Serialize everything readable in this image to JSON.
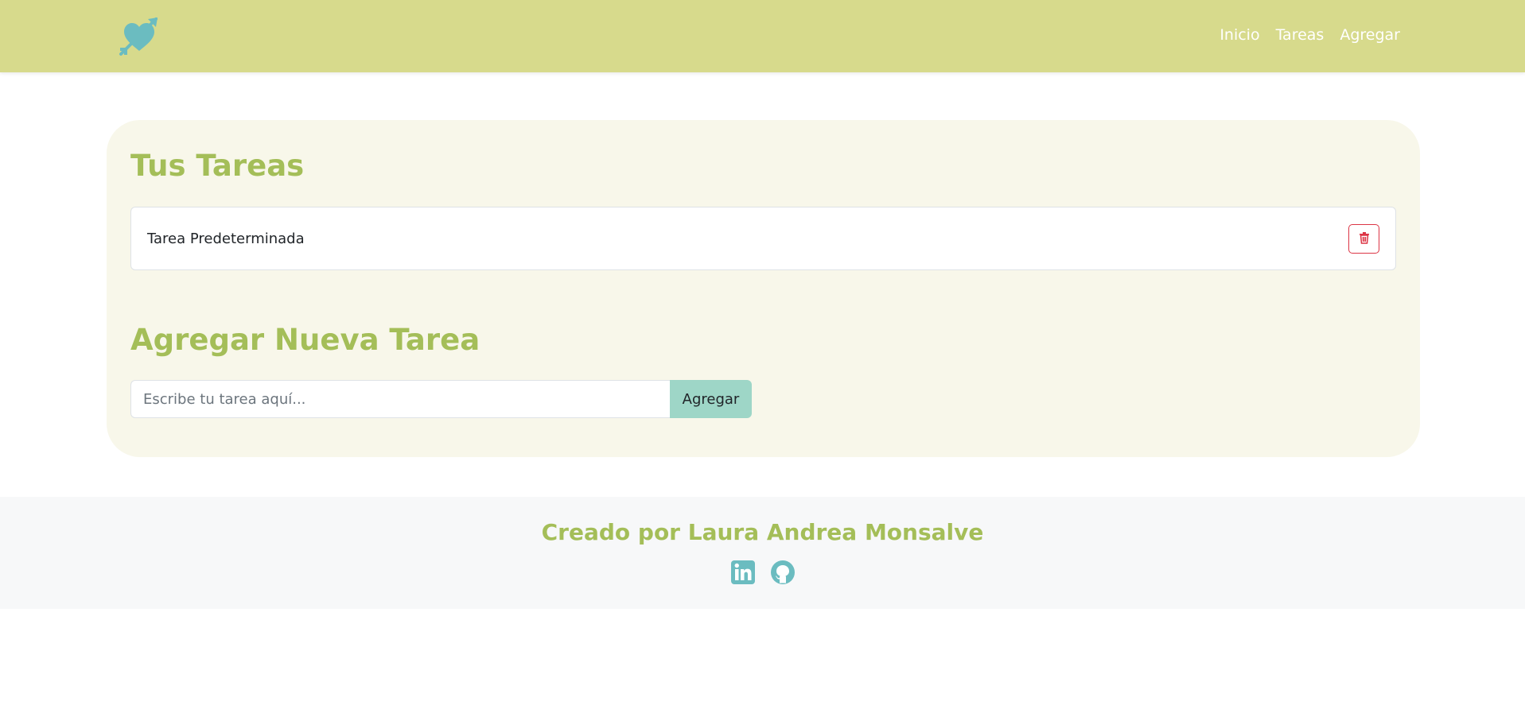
{
  "navbar": {
    "logo_icon": "heart-arrow-icon",
    "links": [
      {
        "label": "Inicio"
      },
      {
        "label": "Tareas"
      },
      {
        "label": "Agregar"
      }
    ]
  },
  "tasks": {
    "title": "Tus Tareas",
    "items": [
      {
        "text": "Tarea Predeterminada",
        "action_icon": "trash-icon"
      }
    ]
  },
  "add_task": {
    "title": "Agregar Nueva Tarea",
    "input_placeholder": "Escribe tu tarea aquí...",
    "input_value": "",
    "button_label": "Agregar"
  },
  "footer": {
    "credit": "Creado por Laura Andrea Monsalve",
    "social_icons": [
      "linkedin-icon",
      "github-icon"
    ]
  },
  "colors": {
    "navbar_bg": "#d7da8c",
    "accent_green": "#a4be58",
    "accent_teal": "#6bbcc0",
    "button_mint": "#9ed6c7",
    "card_bg": "#f8f7ea",
    "danger": "#dc3545"
  }
}
